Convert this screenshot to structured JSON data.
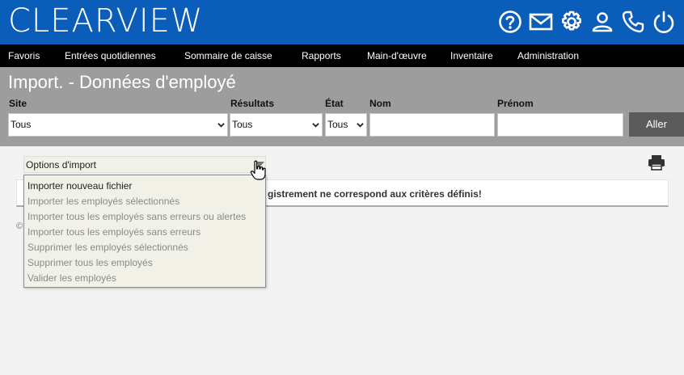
{
  "brand": {
    "logo_text": "CLEARVIEW",
    "header_color": "#0a5db8"
  },
  "header_icons": [
    "help-icon",
    "mail-icon",
    "settings-icon",
    "user-icon",
    "phone-icon",
    "power-icon"
  ],
  "menu": [
    "Favoris",
    "Entrées quotidiennes",
    "Sommaire de caisse",
    "Rapports",
    "Main-d'œuvre",
    "Inventaire",
    "Administration"
  ],
  "page": {
    "title": "Import. - Données d'employé"
  },
  "filters": {
    "site": {
      "label": "Site",
      "value": "Tous"
    },
    "resultats": {
      "label": "Résultats",
      "value": "Tous"
    },
    "etat": {
      "label": "État",
      "value": "Tous"
    },
    "nom": {
      "label": "Nom",
      "value": ""
    },
    "prenom": {
      "label": "Prénom",
      "value": ""
    },
    "go_label": "Aller"
  },
  "import_options": {
    "label": "Options d'import",
    "items": [
      {
        "label": "Importer nouveau fichier",
        "enabled": true
      },
      {
        "label": "Importer les employés sélectionnés",
        "enabled": false
      },
      {
        "label": "Importer tous les employés sans erreurs ou alertes",
        "enabled": false
      },
      {
        "label": "Importer tous les employés sans erreurs",
        "enabled": false
      },
      {
        "label": "Supprimer les employés sélectionnés",
        "enabled": false
      },
      {
        "label": "Supprimer tous les employés",
        "enabled": false
      },
      {
        "label": "Valider les employés",
        "enabled": false
      }
    ]
  },
  "results": {
    "message": "gistrement ne correspond aux critères définis!"
  },
  "footer": {
    "copyright_glyph": "©"
  }
}
